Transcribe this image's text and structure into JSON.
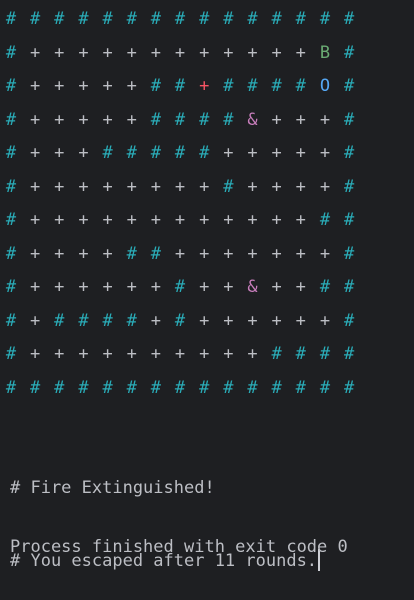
{
  "grid": [
    "# # # # # # # # # # # # # # #",
    "# + + + + + + + + + + + + B #",
    "# + + + + + # # + # # # # O #",
    "# + + + + + # # # # & + + + #",
    "# + + + # # # # # + + + + + #",
    "# + + + + + + + + # + + + + #",
    "# + + + + + + + + + + + + # #",
    "# + + + + # # + + + + + + + #",
    "# + + + + + + # + + & + + # #",
    "# + # # # # + # + + + + + + #",
    "# + + + + + + + + + + # # # #",
    "# # # # # # # # # # # # # # #"
  ],
  "colors": {
    "wall": "#2aacb8",
    "floor": "#bcbec4",
    "fire": "#f75464",
    "bunny": "#6aab73",
    "exit": "#56a8f5",
    "player": "#c77dbb",
    "background": "#1e1f22"
  },
  "output": {
    "line1": "# Fire Extinguished!",
    "line2": "# You escaped after 11 rounds."
  },
  "process": {
    "message": "Process finished with exit code 0"
  }
}
